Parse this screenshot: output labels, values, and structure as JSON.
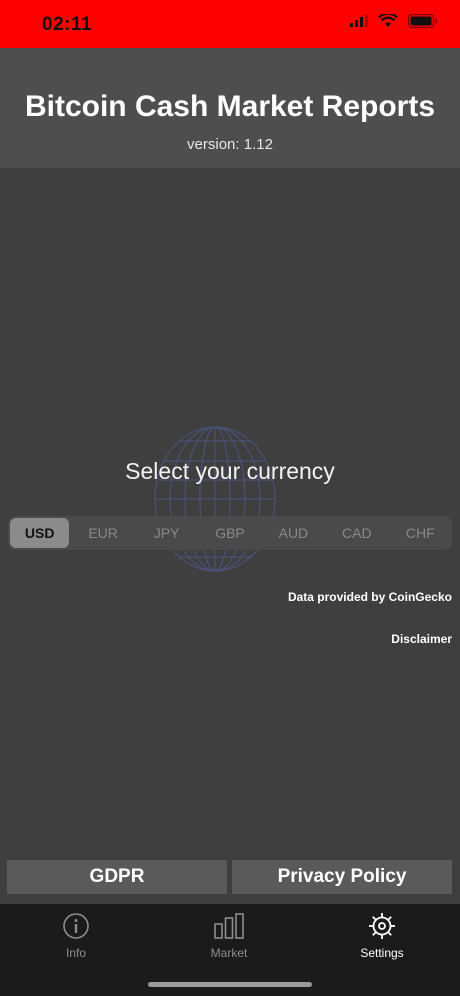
{
  "status_bar": {
    "time": "02:11"
  },
  "header": {
    "title": "Bitcoin Cash Market Reports",
    "version": "version: 1.12"
  },
  "currency": {
    "heading": "Select your currency",
    "options": [
      "USD",
      "EUR",
      "JPY",
      "GBP",
      "AUD",
      "CAD",
      "CHF"
    ],
    "selected": "USD"
  },
  "credit": "Data provided by CoinGecko",
  "disclaimer": "Disclaimer",
  "buttons": {
    "gdpr": "GDPR",
    "privacy": "Privacy Policy"
  },
  "tabs": [
    {
      "label": "Info",
      "icon": "info-icon"
    },
    {
      "label": "Market",
      "icon": "chart-bars-icon"
    },
    {
      "label": "Settings",
      "icon": "gear-icon",
      "active": true
    }
  ],
  "colors": {
    "status_bar": "#ff0000",
    "background": "#3f3f3f",
    "header": "#4e4e4e"
  }
}
